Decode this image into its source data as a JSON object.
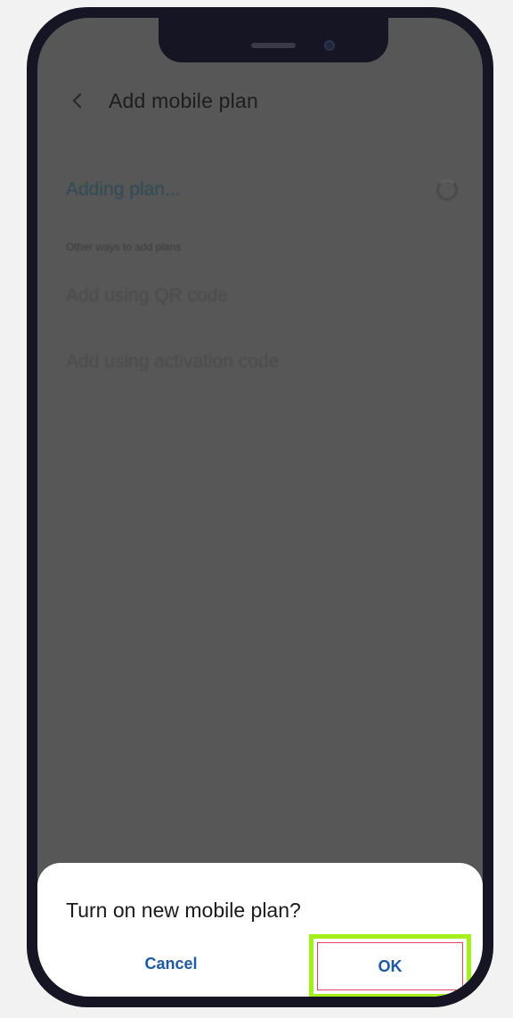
{
  "app": {
    "title": "Add mobile plan",
    "adding_label": "Adding plan...",
    "section_header": "Other ways to add plans",
    "options": [
      "Add using QR code",
      "Add using activation code"
    ]
  },
  "dialog": {
    "title": "Turn on new mobile plan?",
    "cancel_label": "Cancel",
    "ok_label": "OK"
  },
  "icons": {
    "back": "chevron-left-icon",
    "spinner": "spinner-icon"
  },
  "colors": {
    "highlight": "#a4f01a",
    "button_text": "#1e5aa0",
    "dim_overlay": "#575757"
  }
}
